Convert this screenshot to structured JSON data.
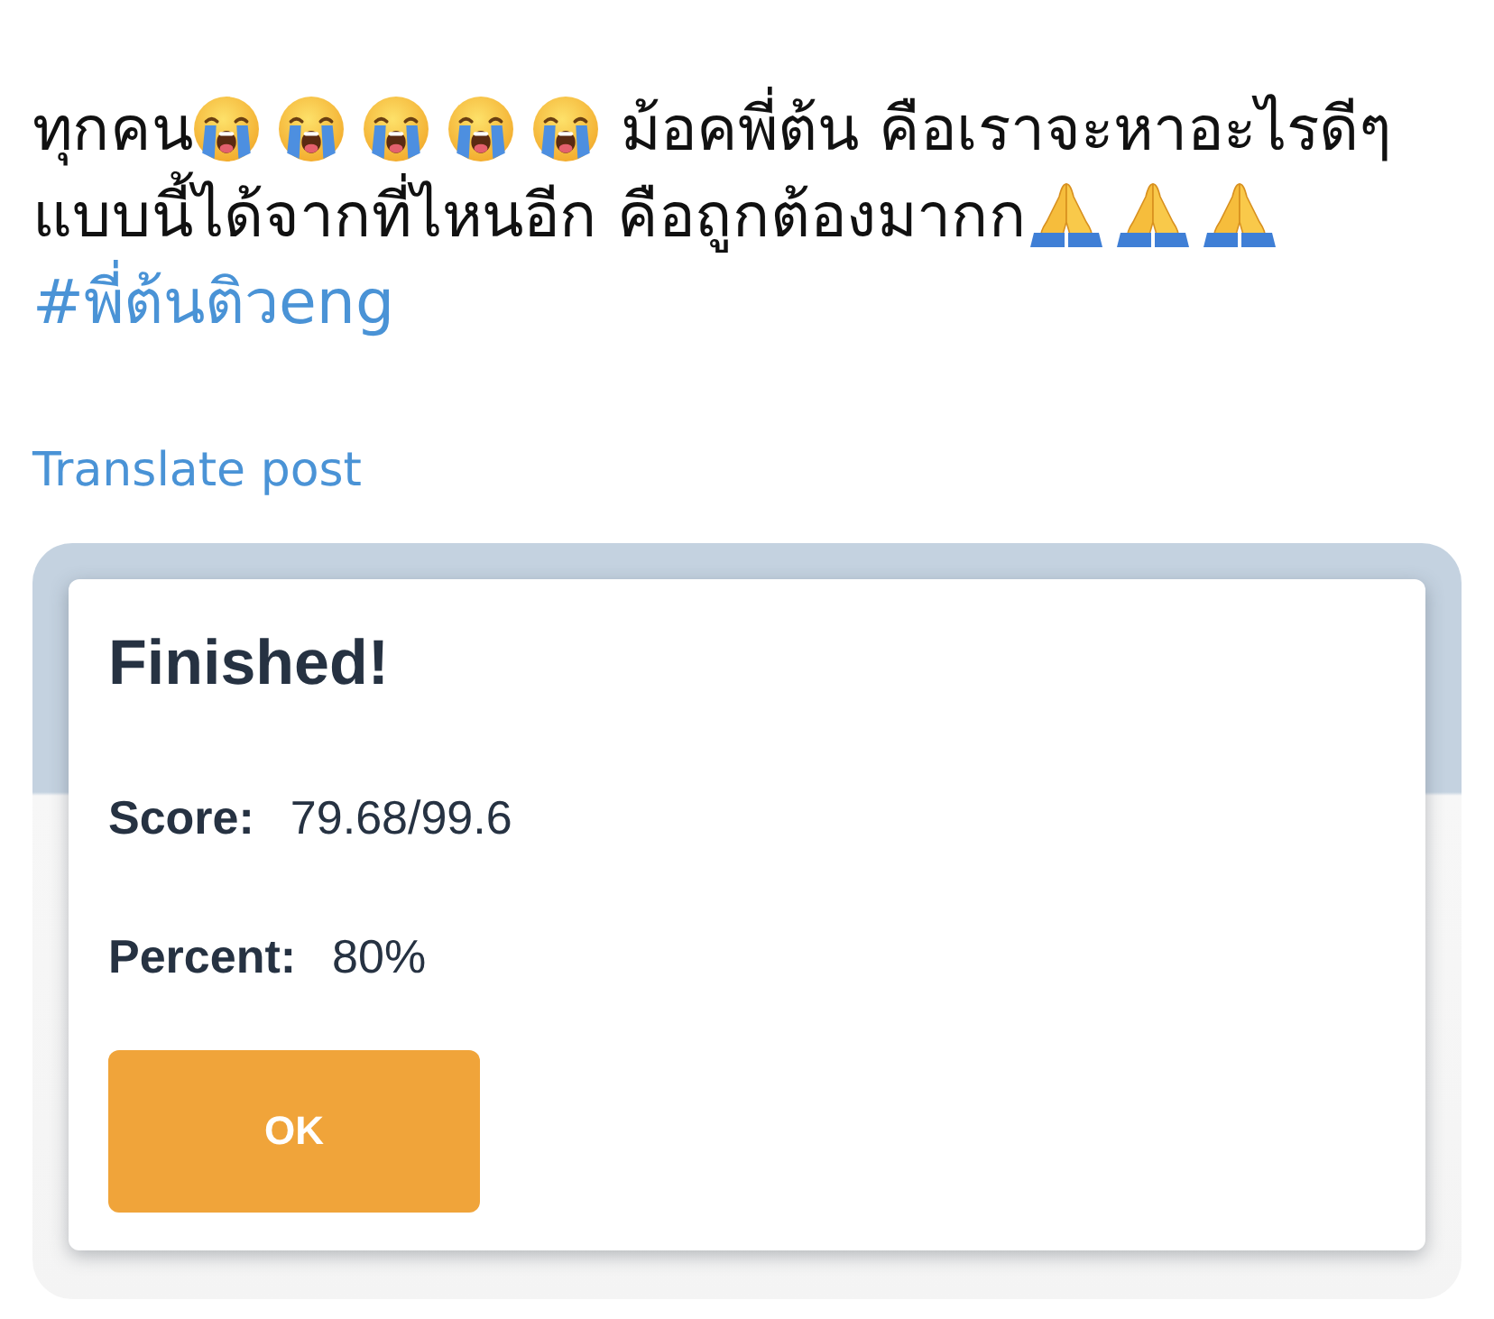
{
  "post": {
    "lines": [
      [
        {
          "kind": "text",
          "text": "ทุกคน"
        },
        {
          "kind": "crying_face"
        },
        {
          "kind": "crying_face"
        },
        {
          "kind": "crying_face"
        },
        {
          "kind": "crying_face"
        },
        {
          "kind": "crying_face"
        },
        {
          "kind": "text",
          "text": "ม้อคพี่ต้น คือเราจะหาอะไรดีๆ"
        }
      ],
      [
        {
          "kind": "text",
          "text": "แบบนี้ได้จากที่ไหนอีก คือถูกต้องมากก"
        },
        {
          "kind": "folded_hands"
        },
        {
          "kind": "folded_hands"
        },
        {
          "kind": "folded_hands"
        }
      ],
      [
        {
          "kind": "hashtag",
          "text": "#พี่ต้นติวeng"
        }
      ]
    ],
    "translate_link": "Translate post"
  },
  "attached_image": {
    "dialog": {
      "title": "Finished!",
      "fields": [
        {
          "label": "Score:",
          "value": "79.68/99.6"
        },
        {
          "label": "Percent:",
          "value": "80%"
        }
      ],
      "button": "OK"
    }
  }
}
